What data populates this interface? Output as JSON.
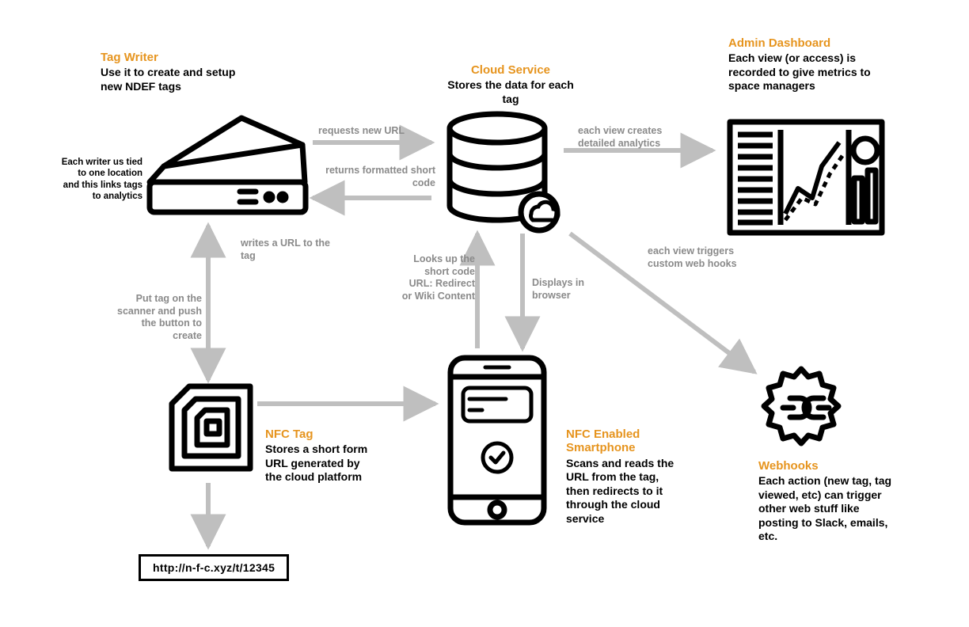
{
  "nodes": {
    "tagWriter": {
      "title": "Tag Writer",
      "desc": "Use it to create and setup new NDEF tags",
      "sideNote": "Each writer us tied to one location and this links tags to analytics"
    },
    "cloudService": {
      "title": "Cloud Service",
      "desc": "Stores the data for each tag"
    },
    "adminDashboard": {
      "title": "Admin Dashboard",
      "desc": "Each view (or access) is recorded to give metrics to space managers"
    },
    "nfcTag": {
      "title": "NFC Tag",
      "desc": "Stores a short form URL generated by the cloud platform"
    },
    "smartphone": {
      "title": "NFC Enabled Smartphone",
      "desc": "Scans and reads the URL from the tag, then redirects to it through the cloud service"
    },
    "webhooks": {
      "title": "Webhooks",
      "desc": "Each action (new tag, tag viewed, etc) can trigger other web stuff like posting to Slack, emails, etc."
    }
  },
  "edges": {
    "requestsNewUrl": "requests new URL",
    "returnsShortCode": "returns formatted short code",
    "writesUrl": "writes a URL to the tag",
    "putTag": "Put tag on the scanner and push the button to create",
    "looksUp": "Looks up the short code URL: Redirect or Wiki Content",
    "displays": "Displays in browser",
    "analytics": "each view creates detailed analytics",
    "triggers": "each view triggers custom web hooks"
  },
  "url": "http://n-f-c.xyz/t/12345"
}
